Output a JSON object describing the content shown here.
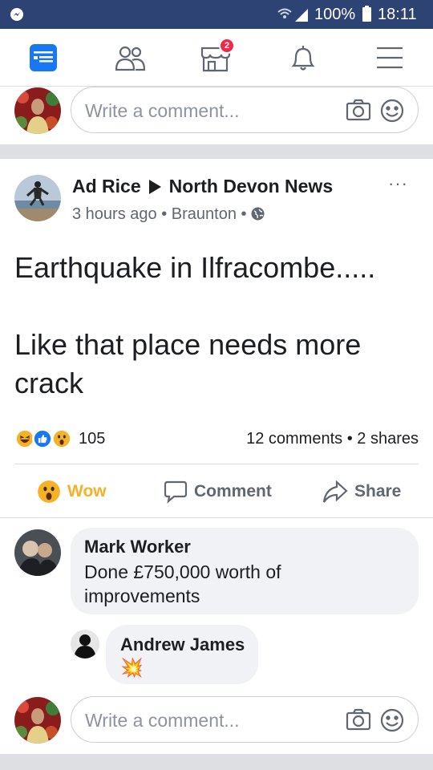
{
  "status_bar": {
    "battery_percent": "100%",
    "time": "18:11"
  },
  "nav": {
    "items": [
      "news-feed",
      "friends",
      "marketplace",
      "notifications",
      "menu"
    ],
    "marketplace_badge": "2"
  },
  "composer_top": {
    "placeholder": "Write a comment..."
  },
  "post": {
    "author": "Ad Rice",
    "target": "North Devon News",
    "time": "3 hours ago",
    "location": "Braunton",
    "more": "···",
    "text": "Earthquake in Ilfracombe.....\n\nLike that place needs more crack",
    "reaction_count": "105",
    "reaction_types": [
      "haha",
      "like",
      "wow"
    ],
    "comments_count": "12 comments",
    "shares_count": "2 shares",
    "meta_separator": "•"
  },
  "actions": {
    "wow_label": "Wow",
    "comment_label": "Comment",
    "share_label": "Share"
  },
  "comments": [
    {
      "author": "Mark Worker",
      "text": "Done £750,000 worth of\nimprovements"
    },
    {
      "author": "Andrew James",
      "text": "💥"
    }
  ],
  "composer_bottom": {
    "placeholder": "Write a comment..."
  },
  "colors": {
    "status_bar": "#2d4373",
    "brand_blue": "#1877f2",
    "badge_red": "#f02849",
    "wow_yellow": "#f7b125",
    "bubble_gray": "#f0f2f5",
    "divider_gray": "#dddfe2"
  }
}
